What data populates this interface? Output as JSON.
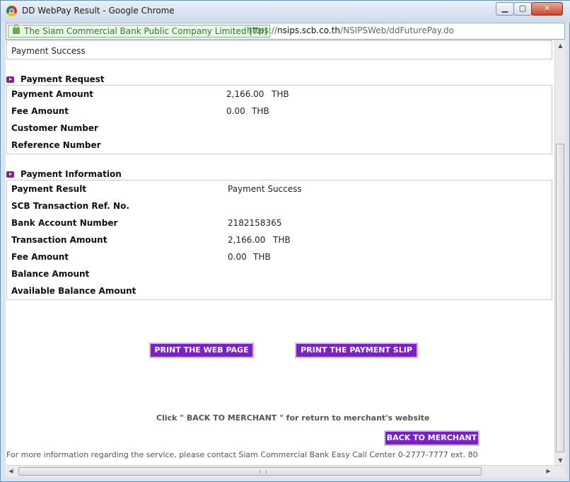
{
  "window": {
    "title": "DD WebPay Result - Google Chrome",
    "buttons": {
      "minimize": "▁",
      "maximize": "▢",
      "close": "✕"
    }
  },
  "address_bar": {
    "ev_label": "The Siam Commercial Bank Public Company Limited [TH]",
    "url_protocol": "https://",
    "url_host": "nsips.scb.co.th",
    "url_path": "/NSIPSWeb/ddFuturePay.do"
  },
  "status": {
    "text": "Payment Success"
  },
  "payment_request": {
    "heading": "Payment Request",
    "payment_amount": {
      "label": "Payment Amount",
      "value": "2,166.00",
      "unit": "THB"
    },
    "fee_amount": {
      "label": "Fee Amount",
      "value": "0.00",
      "unit": "THB"
    },
    "customer_number": {
      "label": "Customer Number",
      "value": ""
    },
    "reference_number": {
      "label": "Reference Number",
      "value": ""
    }
  },
  "payment_information": {
    "heading": "Payment Information",
    "payment_result": {
      "label": "Payment Result",
      "value": "Payment Success"
    },
    "scb_ref": {
      "label": "SCB Transaction Ref. No.",
      "value": ""
    },
    "bank_account": {
      "label": "Bank Account Number",
      "value": "2182158365"
    },
    "transaction_amount": {
      "label": "Transaction Amount",
      "value": "2,166.00",
      "unit": "THB"
    },
    "fee_amount": {
      "label": "Fee Amount",
      "value": "0.00",
      "unit": "THB"
    },
    "balance_amount": {
      "label": "Balance Amount",
      "value": ""
    },
    "available_balance": {
      "label": "Available Balance Amount",
      "value": ""
    }
  },
  "actions": {
    "print_web_page": "PRINT THE WEB PAGE",
    "print_payment_slip": "PRINT THE PAYMENT SLIP",
    "back_note": "Click \" BACK TO MERCHANT \" for return to merchant's website",
    "back_to_merchant": "BACK TO MERCHANT"
  },
  "footer": {
    "text": "For more information regarding the service, please contact Siam Commercial Bank Easy Call Center 0-2777-7777 ext. 80"
  },
  "icons": {
    "browser_logo": "chrome-logo-icon",
    "lock": "lock-icon",
    "section_bullet": "play-bullet-icon"
  },
  "colors": {
    "button_bg": "#7a1fc9",
    "section_bullet": "#7a2a86",
    "ev_green": "#2f7a2f"
  }
}
